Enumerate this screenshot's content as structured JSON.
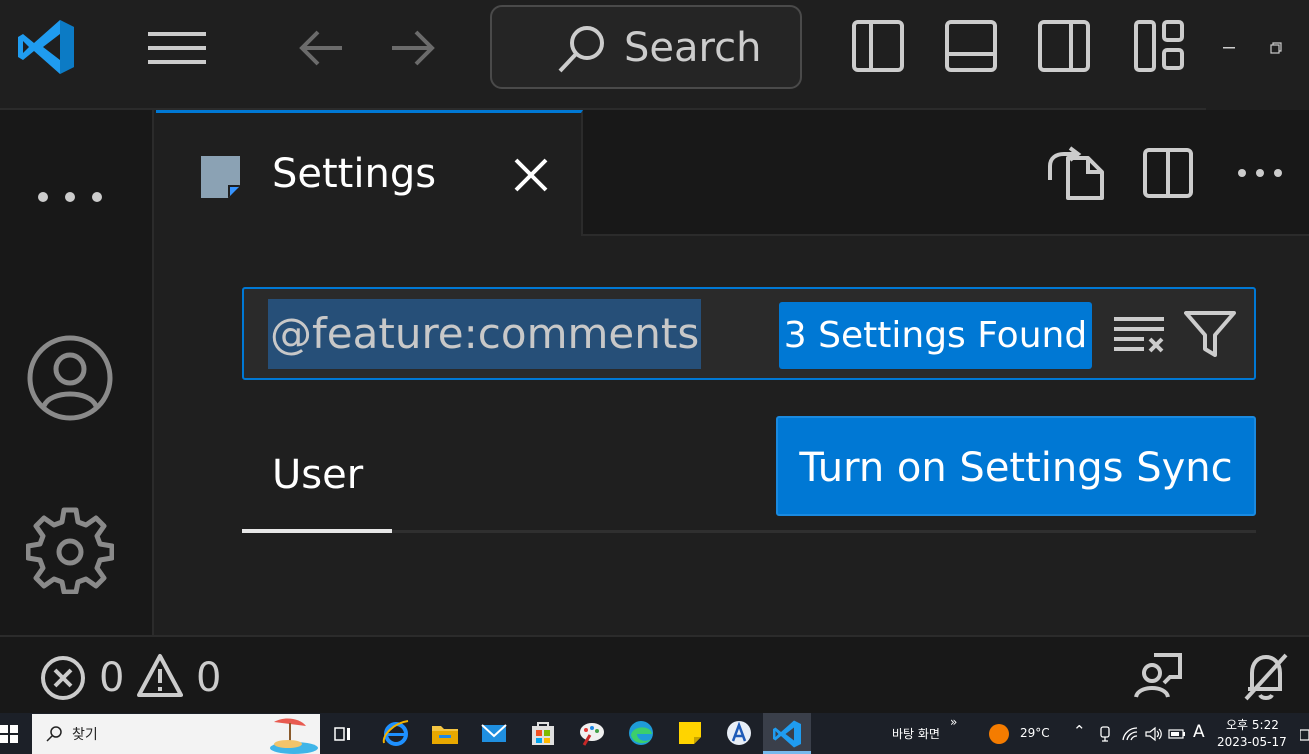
{
  "titlebar": {
    "search_label": "Search",
    "icons": [
      "vscode-logo",
      "menu-icon",
      "back-arrow-icon",
      "forward-arrow-icon",
      "toggle-primary-sidebar-icon",
      "toggle-panel-icon",
      "toggle-secondary-sidebar-icon",
      "customize-layout-icon",
      "minimize-icon",
      "restore-icon"
    ]
  },
  "activitybar": {
    "icons": [
      "more-icon",
      "accounts-icon",
      "manage-gear-icon"
    ]
  },
  "editor": {
    "tab_label": "Settings",
    "actions": [
      "open-settings-json-icon",
      "split-editor-icon",
      "more-actions-icon"
    ],
    "search_value": "@feature:comments",
    "results_count": "3 Settings Found",
    "scope_tab": "User",
    "sync_button": "Turn on Settings Sync"
  },
  "statusbar": {
    "errors": "0",
    "warnings": "0"
  },
  "taskbar": {
    "search_placeholder": "찾기",
    "desktop_label": "바탕 화면",
    "temperature": "29°C",
    "ime": "A",
    "time": "오후 5:22",
    "date": "2023-05-17"
  },
  "colors": {
    "accent": "#0078d4",
    "background": "#1f1f1f",
    "activitybar": "#181818",
    "selection": "#264f78"
  }
}
